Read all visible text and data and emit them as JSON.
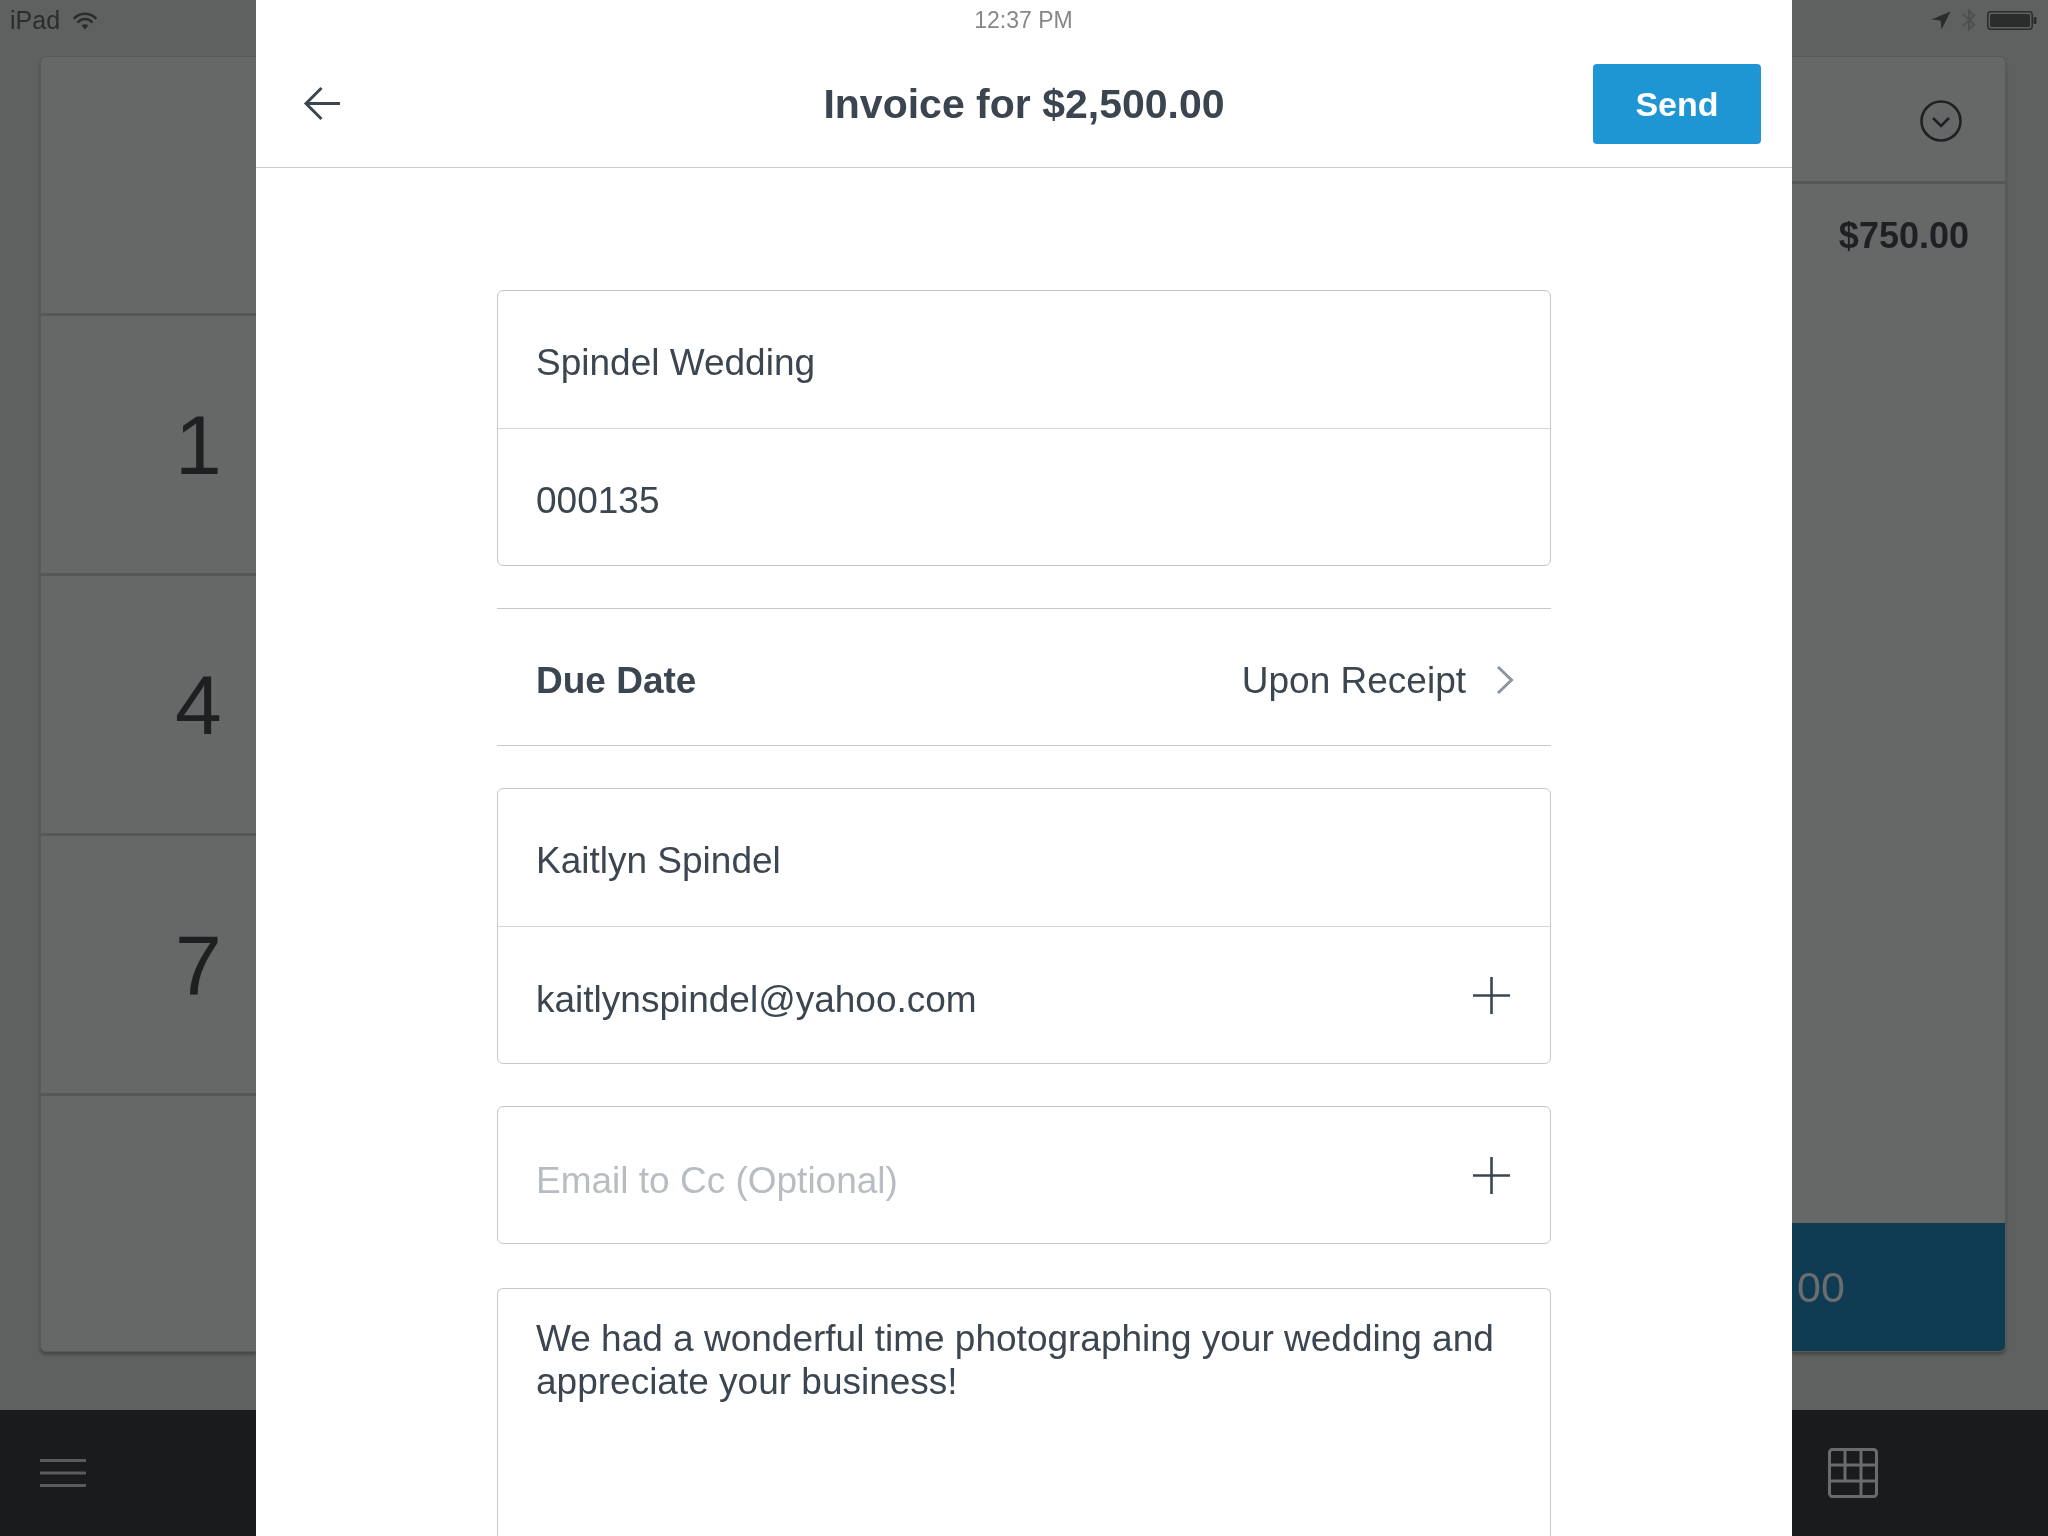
{
  "status_bar": {
    "device": "iPad",
    "time": "12:37 PM"
  },
  "register": {
    "keypad_keys": [
      "1",
      "4",
      "7"
    ],
    "sale_total": "$750.00",
    "charge_button": "00"
  },
  "invoice": {
    "title": "Invoice for $2,500.00",
    "send_button": "Send",
    "details": [
      {
        "value": "Spindel Wedding"
      },
      {
        "value": "000135"
      }
    ],
    "due_date": {
      "label": "Due Date",
      "value": "Upon Receipt"
    },
    "recipient": [
      {
        "kind": "text",
        "value": "Kaitlyn Spindel"
      },
      {
        "kind": "add",
        "value": "kaitlynspindel@yahoo.com"
      }
    ],
    "cc": {
      "placeholder": "Email to Cc (Optional)"
    },
    "message": "We had a wonderful time photographing your wedding and appreciate your business!"
  }
}
